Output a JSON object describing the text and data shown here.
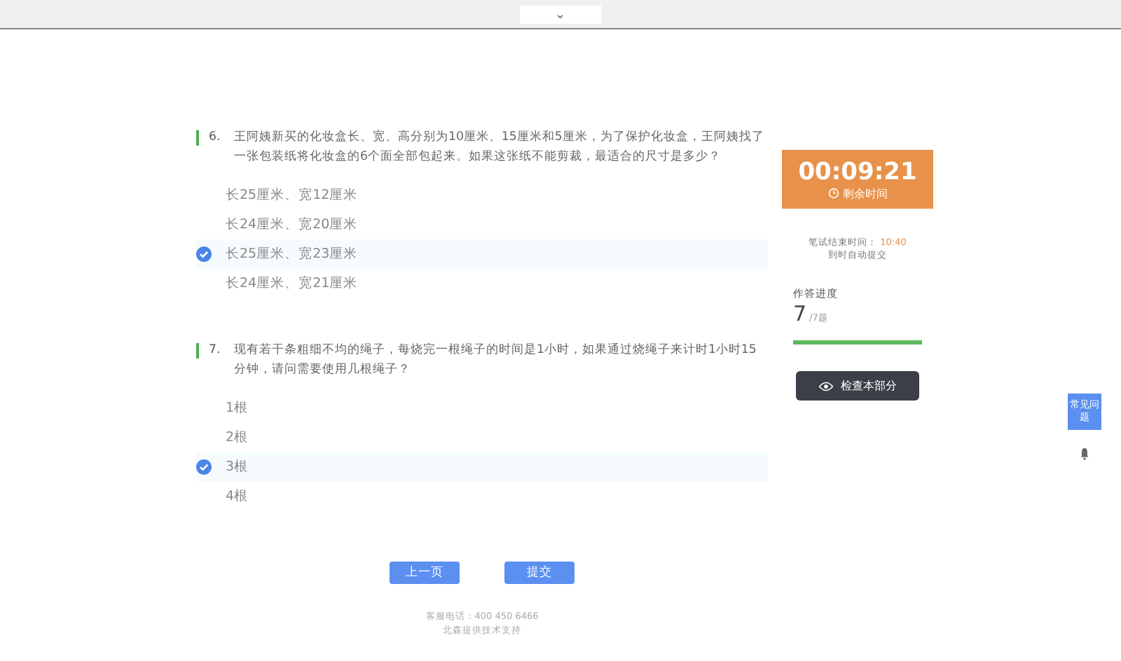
{
  "top_bar": {
    "toggle": "⌄"
  },
  "questions": [
    {
      "number": "6.",
      "text": "王阿姨新买的化妆盒长、宽、高分别为10厘米、15厘米和5厘米，为了保护化妆盒，王阿姨找了一张包装纸将化妆盒的6个面全部包起来。如果这张纸不能剪裁，最适合的尺寸是多少？",
      "options": [
        {
          "label": "长25厘米、宽12厘米",
          "selected": false
        },
        {
          "label": "长24厘米、宽20厘米",
          "selected": false
        },
        {
          "label": "长25厘米、宽23厘米",
          "selected": true
        },
        {
          "label": "长24厘米、宽21厘米",
          "selected": false
        }
      ]
    },
    {
      "number": "7.",
      "text": "现有若干条粗细不均的绳子，每烧完一根绳子的时间是1小时，如果通过烧绳子来计时1小时15分钟，请问需要使用几根绳子？",
      "options": [
        {
          "label": "1根",
          "selected": false
        },
        {
          "label": "2根",
          "selected": false
        },
        {
          "label": "3根",
          "selected": true
        },
        {
          "label": "4根",
          "selected": false
        }
      ]
    }
  ],
  "nav_buttons": [
    "上一页",
    "提交"
  ],
  "footer": {
    "phone": "客服电话：400 450 6466",
    "support": "北森提供技术支持"
  },
  "timer": {
    "time": "00:09:21",
    "label": "剩余时间"
  },
  "end_time": {
    "label": "笔试结束时间：",
    "time": "10:40",
    "note": "到时自动提交"
  },
  "progress": {
    "label": "作答进度",
    "count": "7",
    "total": "/7题",
    "level": 1
  },
  "check_button": "检查本部分",
  "faq_button": "常见问题"
}
